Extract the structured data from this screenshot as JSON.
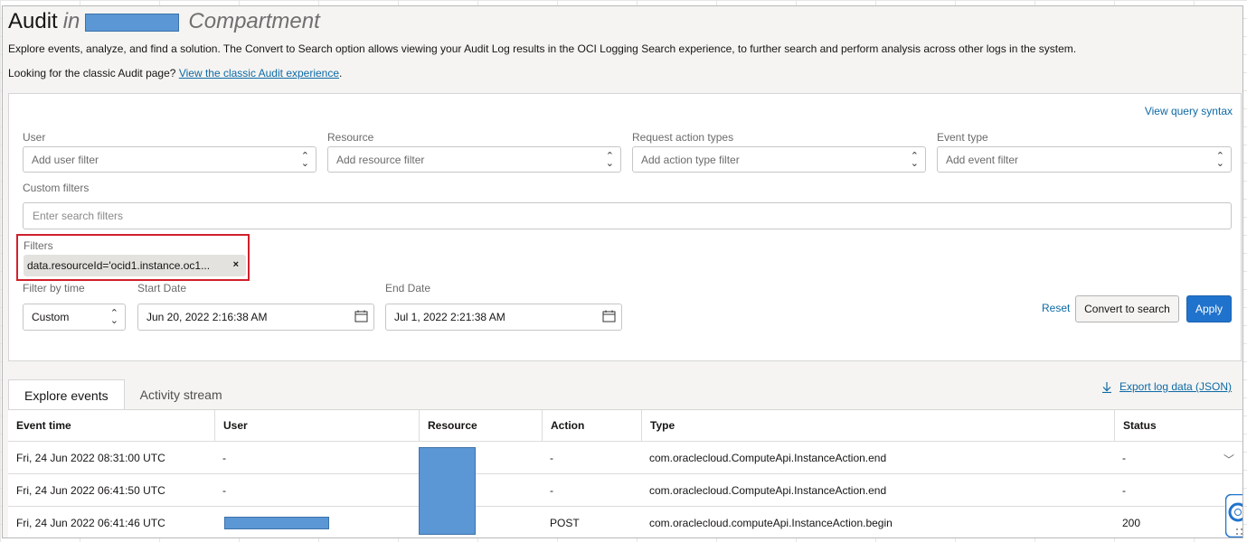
{
  "header": {
    "title": "Audit",
    "title_in": "in",
    "title_suffix": "Compartment",
    "description": "Explore events, analyze, and find a solution. The Convert to Search option allows viewing your Audit Log results in the OCI Logging Search experience, to further search and perform analysis across other logs in the system.",
    "classic_prompt": "Looking for the classic Audit page?",
    "classic_link": "View the classic Audit experience",
    "classic_period": "."
  },
  "filters": {
    "query_syntax_link": "View query syntax",
    "user": {
      "label": "User",
      "placeholder": "Add user filter"
    },
    "resource": {
      "label": "Resource",
      "placeholder": "Add resource filter"
    },
    "request_action": {
      "label": "Request action types",
      "placeholder": "Add action type filter"
    },
    "event_type": {
      "label": "Event type",
      "placeholder": "Add event filter"
    },
    "custom": {
      "label": "Custom filters",
      "placeholder": "Enter search filters"
    },
    "applied": {
      "label": "Filters",
      "chip": "data.resourceId='ocid1.instance.oc1..."
    },
    "time": {
      "label": "Filter by time",
      "value": "Custom"
    },
    "start_date": {
      "label": "Start Date",
      "value": "Jun 20, 2022 2:16:38 AM"
    },
    "end_date": {
      "label": "End Date",
      "value": "Jul 1, 2022 2:21:38 AM"
    },
    "reset": "Reset",
    "convert": "Convert to search",
    "apply": "Apply"
  },
  "tabs": [
    {
      "label": "Explore events",
      "active": true
    },
    {
      "label": "Activity stream",
      "active": false
    }
  ],
  "export_label": "Export log data (JSON)",
  "table": {
    "columns": [
      "Event time",
      "User",
      "Resource",
      "Action",
      "Type",
      "Status"
    ],
    "rows": [
      {
        "event_time": "Fri, 24 Jun 2022 08:31:00 UTC",
        "user": "-",
        "resource": "",
        "action": "-",
        "type": "com.oraclecloud.ComputeApi.InstanceAction.end",
        "status": "-"
      },
      {
        "event_time": "Fri, 24 Jun 2022 06:41:50 UTC",
        "user": "-",
        "resource": "",
        "action": "-",
        "type": "com.oraclecloud.ComputeApi.InstanceAction.end",
        "status": "-"
      },
      {
        "event_time": "Fri, 24 Jun 2022 06:41:46 UTC",
        "user": "",
        "resource": "",
        "action": "POST",
        "type": "com.oraclecloud.computeApi.InstanceAction.begin",
        "status": "200"
      }
    ]
  },
  "colors": {
    "link": "#0e6aa5",
    "primary": "#2073cc",
    "redaction": "#5b97d5",
    "highlight_border": "#d0202c"
  },
  "icons": [
    "chevron-updown-icon",
    "calendar-icon",
    "close-icon",
    "download-icon",
    "chevron-down-icon",
    "help-icon"
  ]
}
